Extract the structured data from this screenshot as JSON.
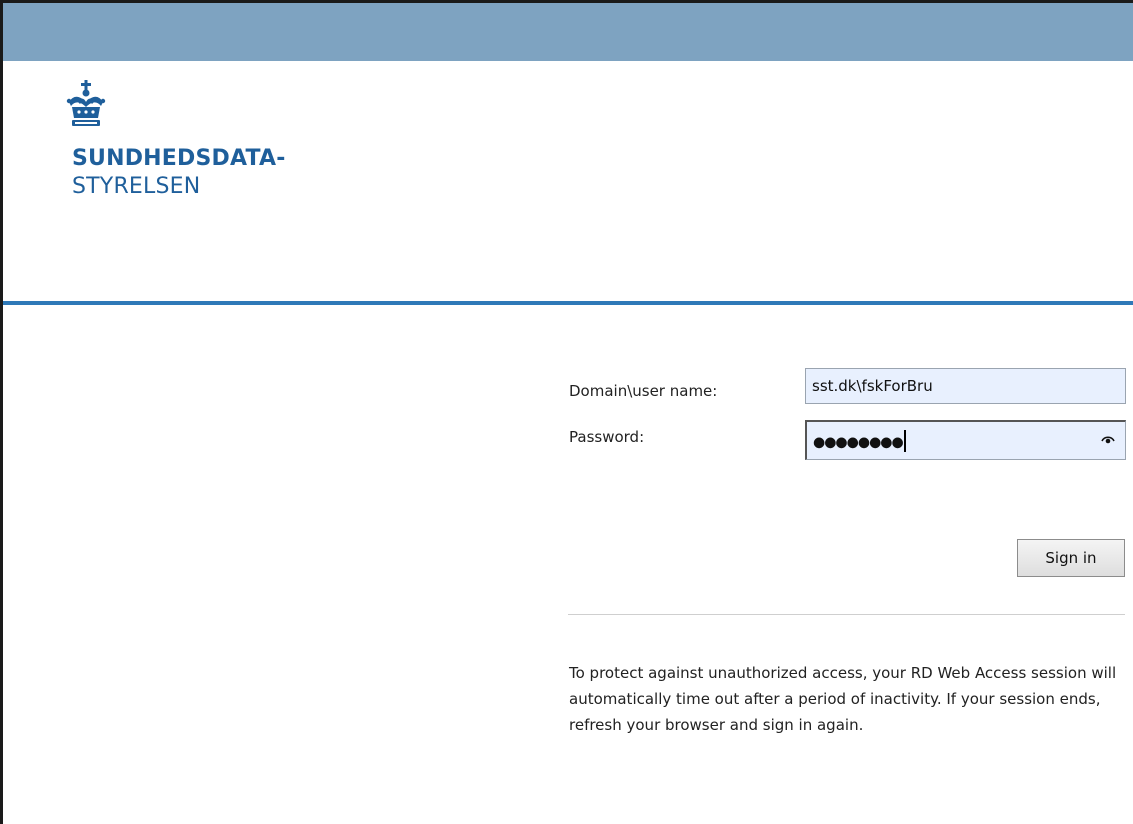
{
  "header": {
    "bar_color": "#7ea3c1"
  },
  "logo": {
    "icon": "crown-icon",
    "line1": "SUNDHEDSDATA-",
    "line2": "STYRELSEN",
    "color": "#1f5f9b"
  },
  "accent_color": "#2e79b8",
  "login": {
    "username_label": "Domain\\user name:",
    "username_value": "sst.dk\\fskForBru",
    "password_label": "Password:",
    "password_value": "●●●●●●●●",
    "reveal_icon": "eye-icon",
    "signin_label": "Sign in"
  },
  "notice": {
    "text": "To protect against unauthorized access, your RD Web Access session will automatically time out after a period of inactivity. If your session ends, refresh your browser and sign in again."
  }
}
